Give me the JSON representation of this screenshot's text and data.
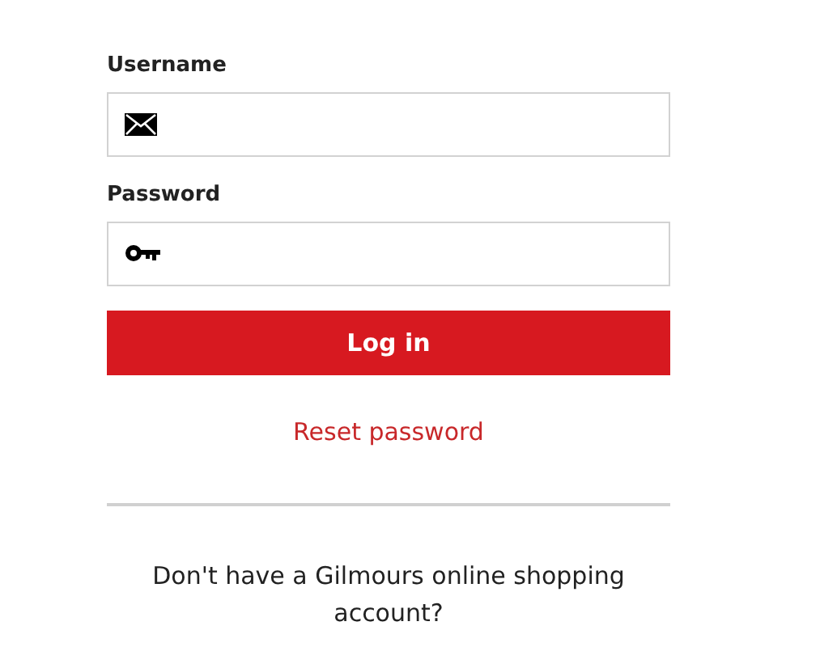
{
  "fields": [
    {
      "label": "Username",
      "kind": "email"
    },
    {
      "label": "Password",
      "kind": "password"
    }
  ],
  "login_button": "Log in",
  "reset_link": "Reset password",
  "signup_prompt": "Don't have a Gilmours online shopping account?"
}
